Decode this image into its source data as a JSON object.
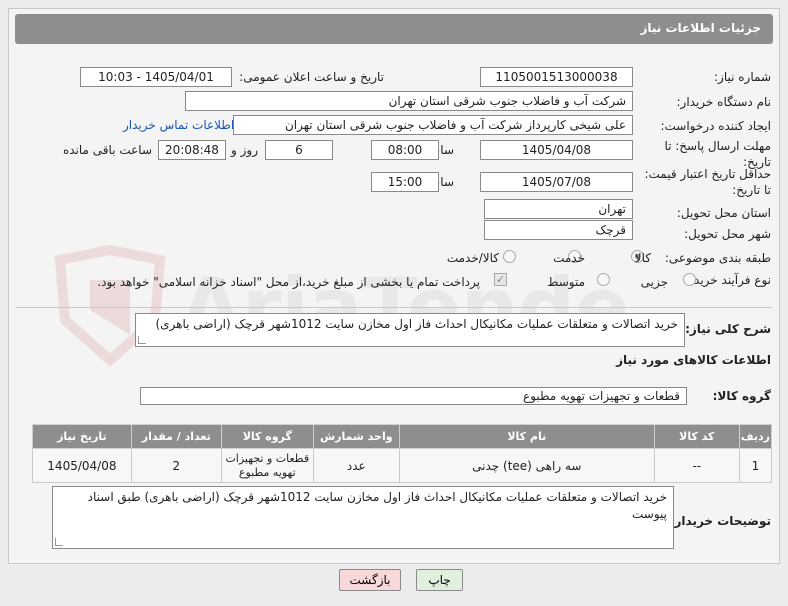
{
  "header": {
    "title": "جزئیات اطلاعات نیاز"
  },
  "labels": {
    "need_number": "شماره نیاز:",
    "announce_datetime": "تاریخ و ساعت اعلان عمومی:",
    "buyer_org": "نام دستگاه خریدار:",
    "requester": "ایجاد کننده درخواست:",
    "response_deadline": "مهلت ارسال پاسخ: تا تاریخ:",
    "price_validity": "حداقل تاریخ اعتبار قیمت: تا تاریخ:",
    "time_word": "ساعت",
    "days_and": "روز و",
    "remaining": "ساعت باقی مانده",
    "province": "استان محل تحویل:",
    "city": "شهر محل تحویل:",
    "category": "طبقه بندی موضوعی:",
    "process_type": "نوع فرآیند خرید :",
    "general_desc": "شرح کلی نیاز:",
    "goods_info": "اطلاعات کالاهای مورد نیاز",
    "goods_group": "گروه کالا:",
    "buyer_notes": "توضیحات خریدار:"
  },
  "values": {
    "need_number": "1105001513000038",
    "announce_datetime": "1405/04/01 - 10:03",
    "buyer_org": "شرکت آب و فاضلاب جنوب شرقی استان تهران",
    "requester": "علی شیخی کارپرداز شرکت آب و فاضلاب جنوب شرقی استان تهران",
    "contact_link": "اطلاعات تماس خریدار",
    "response_date": "1405/04/08",
    "response_time": "08:00",
    "days": "6",
    "remaining_time": "20:08:48",
    "validity_date": "1405/07/08",
    "validity_time": "15:00",
    "province": "تهران",
    "city": "قرچک",
    "general_desc": "خرید اتصالات و متعلقات عملیات مکانیکال احداث فاز اول مخازن سایت 1012شهر قرچک (اراضی باهری)",
    "goods_group": "قطعات و تجهیزات تهویه مطبوع",
    "buyer_notes": "خرید اتصالات و متعلقات عملیات مکانیکال احداث فاز اول مخازن سایت 1012شهر قرچک (اراضی باهری) طبق اسناد پیوست"
  },
  "category_options": [
    {
      "label": "کالا",
      "selected": true
    },
    {
      "label": "خدمت",
      "selected": false
    },
    {
      "label": "کالا/خدمت",
      "selected": false
    }
  ],
  "process_options": [
    {
      "label": "جزیی",
      "selected": false
    },
    {
      "label": "متوسط",
      "selected": false
    }
  ],
  "payment_note": "پرداخت تمام یا بخشی از مبلغ خرید،از محل \"اسناد خزانه اسلامی\" خواهد بود.",
  "table": {
    "headers": [
      "ردیف",
      "کد کالا",
      "نام کالا",
      "واحد شمارش",
      "گروه کالا",
      "تعداد / مقدار",
      "تاریخ نیاز"
    ],
    "rows": [
      [
        "1",
        "--",
        "سه راهی (tee) چدنی",
        "عدد",
        "قطعات و تجهیزات تهویه مطبوع",
        "2",
        "1405/04/08"
      ]
    ]
  },
  "buttons": {
    "print": "چاپ",
    "back": "بازگشت"
  },
  "watermark": "AriaTender.net",
  "colors": {
    "header_bg": "#8e8e8e",
    "link": "#1a56b8",
    "back_btn": "#f8d8d8",
    "print_btn": "#e0f0dc"
  }
}
